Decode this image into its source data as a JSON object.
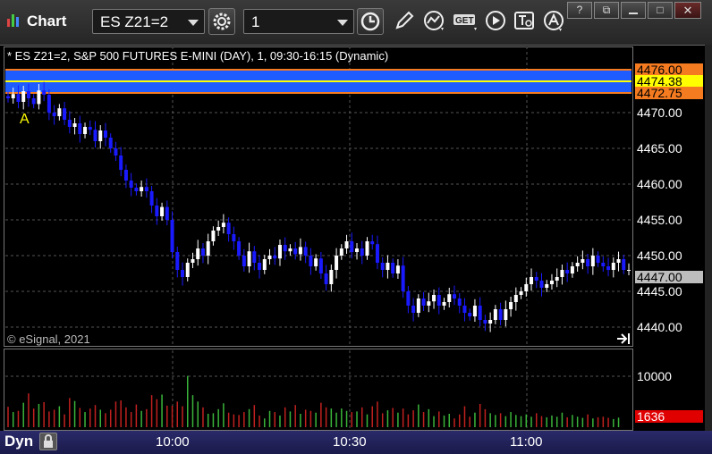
{
  "app": {
    "title": "Chart",
    "symbol_field": "ES Z21=2",
    "interval_field": "1",
    "dyn_label": "Dyn"
  },
  "icons": {
    "chart": "chart-bars-icon",
    "gear": "gear-icon",
    "clock": "clock-icon",
    "draw": "pencil-icon",
    "studies": "studies-icon",
    "get": "get-icon",
    "play": "play-icon",
    "tools": "text-tool-icon",
    "alert": "alert-icon",
    "lock": "lock-icon",
    "jump": "jump-to-end-icon"
  },
  "window_buttons": {
    "help": "?",
    "restore": "⧉",
    "maximize": "□",
    "close": "✕"
  },
  "chart": {
    "info": "* ES Z21=2, S&P 500 FUTURES E-MINI (DAY), 1, 09:30-16:15 (Dynamic)",
    "watermark": "© eSignal, 2021",
    "annotation": "A",
    "price_labels": [
      "4470.00",
      "4465.00",
      "4460.00",
      "4455.00",
      "4450.00",
      "4445.00",
      "4440.00"
    ],
    "price_tags": [
      {
        "label": "4476.00",
        "color": "#f57b20"
      },
      {
        "label": "4474.38",
        "color": "#ffff00"
      },
      {
        "label": "4472.75",
        "color": "#f57b20"
      },
      {
        "label": "4447.00",
        "color": "#bdbdbd"
      }
    ],
    "volume_label": "10000",
    "volume_tag": "1636",
    "time_labels": [
      "10:00",
      "10:30",
      "11:00"
    ],
    "colors": {
      "up": "#ffffff",
      "down": "#1a1aff",
      "band": "#1e5cff",
      "vol_up": "#3ab53a",
      "vol_down": "#c0211f"
    }
  },
  "chart_data": {
    "type": "candlestick",
    "ylim": [
      4437.5,
      4477
    ],
    "time_labels": [
      "10:00",
      "10:30",
      "11:00"
    ],
    "closes": [
      4472.0,
      4472.6,
      4471.5,
      4473.0,
      4472.0,
      4471.2,
      4473.1,
      4472.5,
      4470.0,
      4469.5,
      4470.6,
      4469.0,
      4468.0,
      4468.5,
      4467.0,
      4468.0,
      4467.6,
      4466.0,
      4467.5,
      4466.5,
      4465.0,
      4464.0,
      4462.0,
      4460.5,
      4459.5,
      4459.0,
      4459.6,
      4459.0,
      4457.0,
      4455.5,
      4456.8,
      4455.0,
      4450.5,
      4448.0,
      4447.0,
      4449.0,
      4449.5,
      4451.0,
      4450.0,
      4452.0,
      4453.5,
      4454.0,
      4454.6,
      4453.0,
      4452.0,
      4450.0,
      4448.5,
      4450.6,
      4449.0,
      4448.0,
      4449.5,
      4450.0,
      4449.6,
      4451.5,
      4450.6,
      4451.0,
      4450.2,
      4451.2,
      4450.0,
      4448.5,
      4449.6,
      4447.5,
      4446.0,
      4448.0,
      4450.0,
      4451.0,
      4452.0,
      4450.5,
      4451.0,
      4450.0,
      4452.0,
      4451.6,
      4449.0,
      4448.0,
      4449.0,
      4447.5,
      4448.6,
      4445.0,
      4443.0,
      4442.0,
      4444.0,
      4443.0,
      4443.6,
      4444.5,
      4443.0,
      4443.5,
      4444.6,
      4444.0,
      4443.0,
      4442.0,
      4441.5,
      4443.0,
      4441.0,
      4440.5,
      4441.0,
      4442.5,
      4441.0,
      4442.5,
      4443.5,
      4444.5,
      4445.0,
      4446.0,
      4447.0,
      4446.5,
      4445.5,
      4446.0,
      4446.5,
      4447.0,
      4448.0,
      4447.5,
      4448.5,
      4449.0,
      4449.5,
      4448.5,
      4450.0,
      4449.0,
      4448.5,
      4448.0,
      4449.0,
      4449.5,
      4448.0,
      4448.0
    ],
    "volumes": [
      3500,
      2600,
      2800,
      4200,
      5800,
      3200,
      4000,
      4300,
      2700,
      3000,
      3600,
      2200,
      5000,
      4500,
      3300,
      2600,
      3200,
      3800,
      3000,
      2400,
      3000,
      4400,
      4600,
      3400,
      2600,
      3900,
      2800,
      3100,
      5500,
      4800,
      5600,
      3700,
      3700,
      4400,
      3600,
      8800,
      5500,
      4400,
      3400,
      2300,
      2400,
      3100,
      4100,
      2500,
      2200,
      2100,
      2600,
      3100,
      3800,
      2000,
      1500,
      2800,
      2600,
      2000,
      3400,
      2700,
      3800,
      2300,
      3000,
      2800,
      2500,
      4200,
      3400,
      3200,
      2500,
      3200,
      2800,
      2600,
      2700,
      3400,
      2200,
      3600,
      4400,
      2400,
      2900,
      3300,
      2500,
      3200,
      2200,
      2900,
      3900,
      2600,
      3100,
      1900,
      2700,
      2000,
      2300,
      1500,
      2200,
      3600,
      1800,
      2500,
      4000,
      3100,
      2400,
      2100,
      2400,
      1900,
      2600,
      2100,
      1900,
      2200,
      1800,
      2400,
      1900,
      1700,
      2000,
      1800,
      2500,
      1700,
      2100,
      1800,
      1600,
      2200,
      1500,
      1700,
      1800,
      1600,
      1400,
      1636
    ]
  }
}
